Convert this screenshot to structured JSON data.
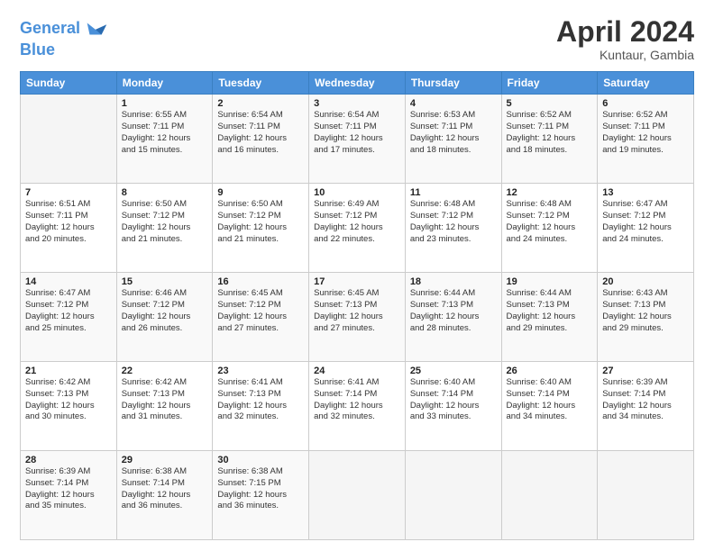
{
  "header": {
    "logo_line1": "General",
    "logo_line2": "Blue",
    "month_title": "April 2024",
    "location": "Kuntaur, Gambia"
  },
  "days_of_week": [
    "Sunday",
    "Monday",
    "Tuesday",
    "Wednesday",
    "Thursday",
    "Friday",
    "Saturday"
  ],
  "weeks": [
    [
      {
        "day": "",
        "info": ""
      },
      {
        "day": "1",
        "info": "Sunrise: 6:55 AM\nSunset: 7:11 PM\nDaylight: 12 hours\nand 15 minutes."
      },
      {
        "day": "2",
        "info": "Sunrise: 6:54 AM\nSunset: 7:11 PM\nDaylight: 12 hours\nand 16 minutes."
      },
      {
        "day": "3",
        "info": "Sunrise: 6:54 AM\nSunset: 7:11 PM\nDaylight: 12 hours\nand 17 minutes."
      },
      {
        "day": "4",
        "info": "Sunrise: 6:53 AM\nSunset: 7:11 PM\nDaylight: 12 hours\nand 18 minutes."
      },
      {
        "day": "5",
        "info": "Sunrise: 6:52 AM\nSunset: 7:11 PM\nDaylight: 12 hours\nand 18 minutes."
      },
      {
        "day": "6",
        "info": "Sunrise: 6:52 AM\nSunset: 7:11 PM\nDaylight: 12 hours\nand 19 minutes."
      }
    ],
    [
      {
        "day": "7",
        "info": "Sunrise: 6:51 AM\nSunset: 7:11 PM\nDaylight: 12 hours\nand 20 minutes."
      },
      {
        "day": "8",
        "info": "Sunrise: 6:50 AM\nSunset: 7:12 PM\nDaylight: 12 hours\nand 21 minutes."
      },
      {
        "day": "9",
        "info": "Sunrise: 6:50 AM\nSunset: 7:12 PM\nDaylight: 12 hours\nand 21 minutes."
      },
      {
        "day": "10",
        "info": "Sunrise: 6:49 AM\nSunset: 7:12 PM\nDaylight: 12 hours\nand 22 minutes."
      },
      {
        "day": "11",
        "info": "Sunrise: 6:48 AM\nSunset: 7:12 PM\nDaylight: 12 hours\nand 23 minutes."
      },
      {
        "day": "12",
        "info": "Sunrise: 6:48 AM\nSunset: 7:12 PM\nDaylight: 12 hours\nand 24 minutes."
      },
      {
        "day": "13",
        "info": "Sunrise: 6:47 AM\nSunset: 7:12 PM\nDaylight: 12 hours\nand 24 minutes."
      }
    ],
    [
      {
        "day": "14",
        "info": "Sunrise: 6:47 AM\nSunset: 7:12 PM\nDaylight: 12 hours\nand 25 minutes."
      },
      {
        "day": "15",
        "info": "Sunrise: 6:46 AM\nSunset: 7:12 PM\nDaylight: 12 hours\nand 26 minutes."
      },
      {
        "day": "16",
        "info": "Sunrise: 6:45 AM\nSunset: 7:12 PM\nDaylight: 12 hours\nand 27 minutes."
      },
      {
        "day": "17",
        "info": "Sunrise: 6:45 AM\nSunset: 7:13 PM\nDaylight: 12 hours\nand 27 minutes."
      },
      {
        "day": "18",
        "info": "Sunrise: 6:44 AM\nSunset: 7:13 PM\nDaylight: 12 hours\nand 28 minutes."
      },
      {
        "day": "19",
        "info": "Sunrise: 6:44 AM\nSunset: 7:13 PM\nDaylight: 12 hours\nand 29 minutes."
      },
      {
        "day": "20",
        "info": "Sunrise: 6:43 AM\nSunset: 7:13 PM\nDaylight: 12 hours\nand 29 minutes."
      }
    ],
    [
      {
        "day": "21",
        "info": "Sunrise: 6:42 AM\nSunset: 7:13 PM\nDaylight: 12 hours\nand 30 minutes."
      },
      {
        "day": "22",
        "info": "Sunrise: 6:42 AM\nSunset: 7:13 PM\nDaylight: 12 hours\nand 31 minutes."
      },
      {
        "day": "23",
        "info": "Sunrise: 6:41 AM\nSunset: 7:13 PM\nDaylight: 12 hours\nand 32 minutes."
      },
      {
        "day": "24",
        "info": "Sunrise: 6:41 AM\nSunset: 7:14 PM\nDaylight: 12 hours\nand 32 minutes."
      },
      {
        "day": "25",
        "info": "Sunrise: 6:40 AM\nSunset: 7:14 PM\nDaylight: 12 hours\nand 33 minutes."
      },
      {
        "day": "26",
        "info": "Sunrise: 6:40 AM\nSunset: 7:14 PM\nDaylight: 12 hours\nand 34 minutes."
      },
      {
        "day": "27",
        "info": "Sunrise: 6:39 AM\nSunset: 7:14 PM\nDaylight: 12 hours\nand 34 minutes."
      }
    ],
    [
      {
        "day": "28",
        "info": "Sunrise: 6:39 AM\nSunset: 7:14 PM\nDaylight: 12 hours\nand 35 minutes."
      },
      {
        "day": "29",
        "info": "Sunrise: 6:38 AM\nSunset: 7:14 PM\nDaylight: 12 hours\nand 36 minutes."
      },
      {
        "day": "30",
        "info": "Sunrise: 6:38 AM\nSunset: 7:15 PM\nDaylight: 12 hours\nand 36 minutes."
      },
      {
        "day": "",
        "info": ""
      },
      {
        "day": "",
        "info": ""
      },
      {
        "day": "",
        "info": ""
      },
      {
        "day": "",
        "info": ""
      }
    ]
  ]
}
